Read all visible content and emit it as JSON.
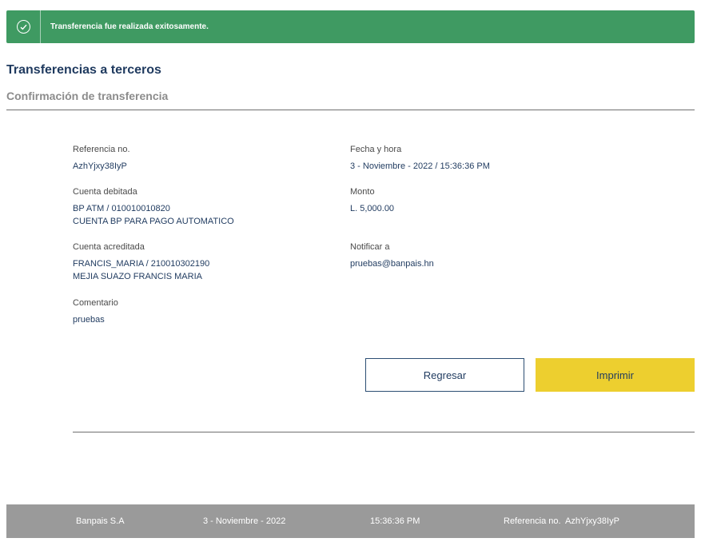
{
  "alert": {
    "message": "Transferencia fue realizada exitosamente.",
    "icon": "check-circle-icon"
  },
  "page": {
    "title": "Transferencias a terceros",
    "subtitle": "Confirmación de transferencia"
  },
  "details": {
    "referencia": {
      "label": "Referencia no.",
      "value": "AzhYjxy38IyP"
    },
    "fecha": {
      "label": "Fecha y hora",
      "value": "3 - Noviembre - 2022 / 15:36:36 PM"
    },
    "cuenta_debitada": {
      "label": "Cuenta debitada",
      "line1": "BP ATM / 010010010820",
      "line2": "CUENTA BP PARA PAGO AUTOMATICO"
    },
    "monto": {
      "label": "Monto",
      "value": "L. 5,000.00"
    },
    "cuenta_acreditada": {
      "label": "Cuenta acreditada",
      "line1": "FRANCIS_MARIA / 210010302190",
      "line2": "MEJIA SUAZO FRANCIS MARIA"
    },
    "notificar": {
      "label": "Notificar a",
      "value": "pruebas@banpais.hn"
    },
    "comentario": {
      "label": "Comentario",
      "value": "pruebas"
    }
  },
  "buttons": {
    "back_label": "Regresar",
    "print_label": "Imprimir"
  },
  "footer": {
    "company": "Banpais S.A",
    "date": "3 - Noviembre - 2022",
    "time": "15:36:36 PM",
    "reference": "Referencia no.  AzhYjxy38IyP"
  },
  "colors": {
    "success": "#3f9a62",
    "primary_text": "#1f3a5f",
    "accent_button": "#edcf2f",
    "footer_bg": "#9a9a9a"
  }
}
